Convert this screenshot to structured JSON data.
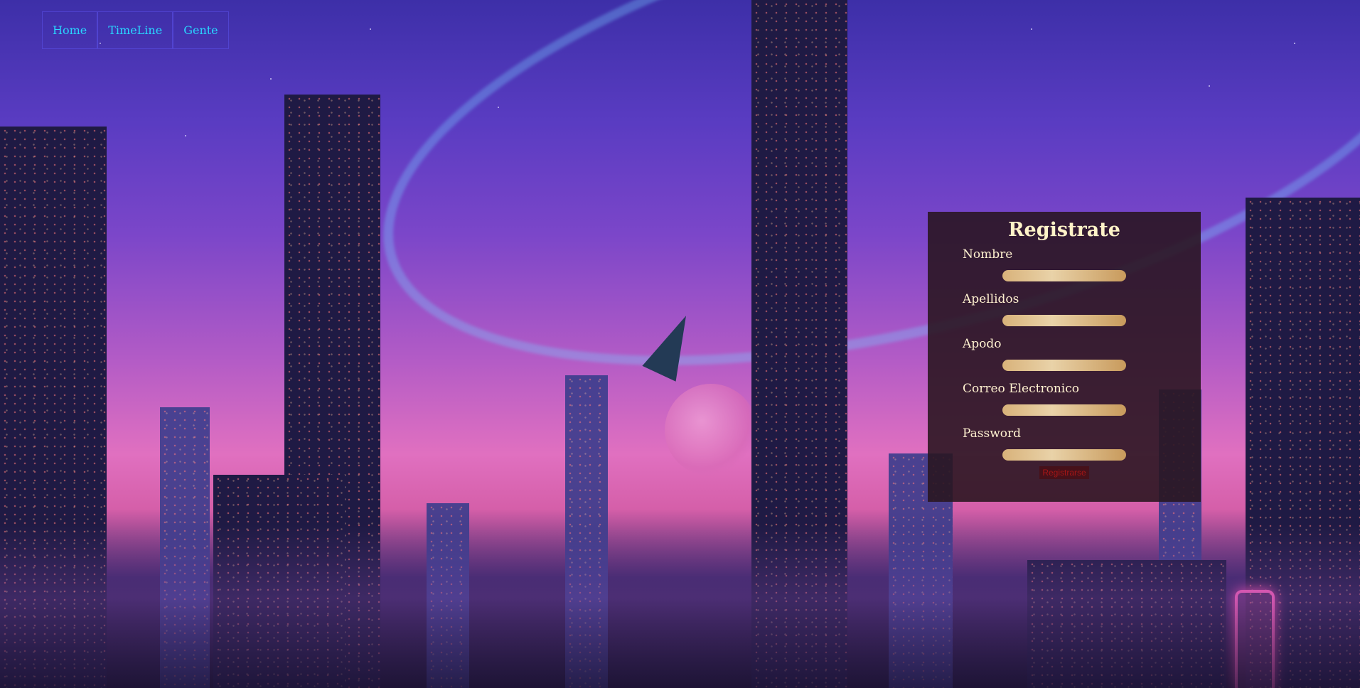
{
  "nav": {
    "items": [
      {
        "label": "Home"
      },
      {
        "label": "TimeLine"
      },
      {
        "label": "Gente"
      }
    ]
  },
  "register": {
    "title": "Registrate",
    "fields": [
      {
        "label": "Nombre",
        "value": ""
      },
      {
        "label": "Apellidos",
        "value": ""
      },
      {
        "label": "Apodo",
        "value": ""
      },
      {
        "label": "Correo Electronico",
        "value": ""
      },
      {
        "label": "Password",
        "value": ""
      }
    ],
    "submit_label": "Registrarse"
  },
  "colors": {
    "nav_link": "#29d6ff",
    "panel_bg": "#28141e",
    "input_fill": "#d8b27a",
    "submit_text": "#a51616"
  }
}
